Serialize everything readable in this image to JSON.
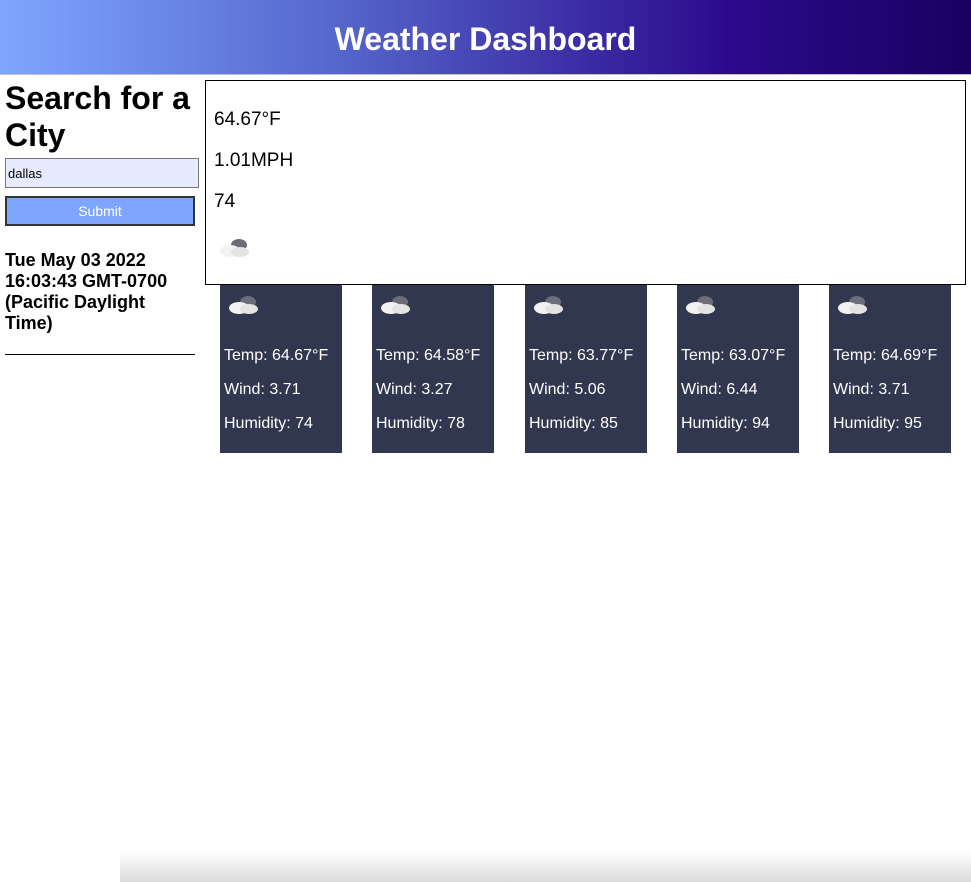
{
  "header": {
    "title": "Weather Dashboard"
  },
  "sidebar": {
    "heading": "Search for a City",
    "search_value": "dallas",
    "submit_label": "Submit",
    "date": "Tue May 03 2022 16:03:43 GMT-0700 (Pacific Daylight Time)"
  },
  "current": {
    "temp": "64.67°F",
    "wind": "1.01MPH",
    "humidity": "74",
    "icon": "partly-cloudy-icon"
  },
  "forecast": [
    {
      "temp": "Temp: 64.67°F",
      "wind": "Wind: 3.71",
      "humidity": "Humidity: 74",
      "icon": "partly-cloudy-icon"
    },
    {
      "temp": "Temp: 64.58°F",
      "wind": "Wind: 3.27",
      "humidity": "Humidity: 78",
      "icon": "partly-cloudy-icon"
    },
    {
      "temp": "Temp: 63.77°F",
      "wind": "Wind: 5.06",
      "humidity": "Humidity: 85",
      "icon": "partly-cloudy-icon"
    },
    {
      "temp": "Temp: 63.07°F",
      "wind": "Wind: 6.44",
      "humidity": "Humidity: 94",
      "icon": "partly-cloudy-icon"
    },
    {
      "temp": "Temp: 64.69°F",
      "wind": "Wind: 3.71",
      "humidity": "Humidity: 95",
      "icon": "partly-cloudy-icon"
    }
  ],
  "colors": {
    "header_gradient_start": "#7fa6ff",
    "header_gradient_end": "#1a0060",
    "card_bg": "#30374f",
    "button_bg": "#7fa6ff",
    "input_bg": "#e8ebff"
  }
}
